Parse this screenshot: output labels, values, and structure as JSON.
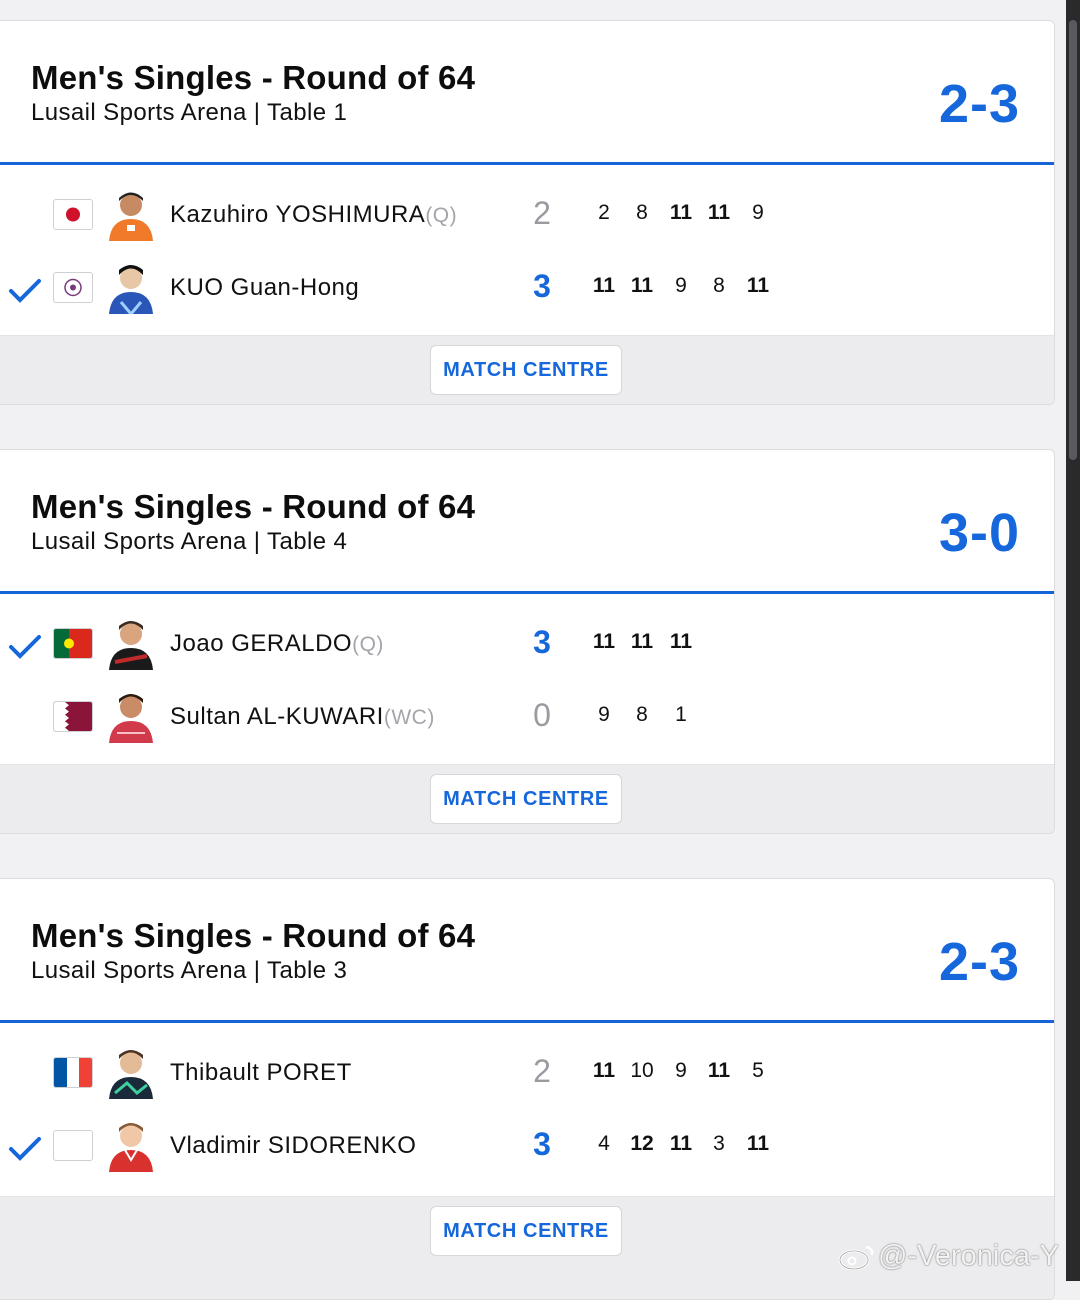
{
  "matches": [
    {
      "title": "Men's Singles - Round of 64",
      "venue": "Lusail Sports Arena | Table 1",
      "total": "2-3",
      "players": [
        {
          "name": "Kazuhiro YOSHIMURA",
          "tag": "(Q)",
          "flag": "japan-flag",
          "winner": false,
          "games": "2",
          "sets": [
            "2",
            "8",
            "11",
            "11",
            "9"
          ],
          "bold": [
            false,
            false,
            true,
            true,
            false
          ]
        },
        {
          "name": "KUO Guan-Hong",
          "tag": "",
          "flag": "chinese-taipei-flag",
          "winner": true,
          "games": "3",
          "sets": [
            "11",
            "11",
            "9",
            "8",
            "11"
          ],
          "bold": [
            true,
            true,
            false,
            false,
            true
          ]
        }
      ],
      "button": "MATCH CENTRE"
    },
    {
      "title": "Men's Singles - Round of 64",
      "venue": "Lusail Sports Arena | Table 4",
      "total": "3-0",
      "players": [
        {
          "name": "Joao GERALDO",
          "tag": "(Q)",
          "flag": "portugal-flag",
          "winner": true,
          "games": "3",
          "sets": [
            "11",
            "11",
            "11"
          ],
          "bold": [
            true,
            true,
            true
          ]
        },
        {
          "name": "Sultan AL-KUWARI",
          "tag": "(WC)",
          "flag": "qatar-flag",
          "winner": false,
          "games": "0",
          "sets": [
            "9",
            "8",
            "1"
          ],
          "bold": [
            false,
            false,
            false
          ]
        }
      ],
      "button": "MATCH CENTRE"
    },
    {
      "title": "Men's Singles - Round of 64",
      "venue": "Lusail Sports Arena | Table 3",
      "total": "2-3",
      "players": [
        {
          "name": "Thibault PORET",
          "tag": "",
          "flag": "france-flag",
          "winner": false,
          "games": "2",
          "sets": [
            "11",
            "10",
            "9",
            "11",
            "5"
          ],
          "bold": [
            true,
            false,
            false,
            true,
            false
          ]
        },
        {
          "name": "Vladimir SIDORENKO",
          "tag": "",
          "flag": "neutral-flag",
          "winner": true,
          "games": "3",
          "sets": [
            "4",
            "12",
            "11",
            "3",
            "11"
          ],
          "bold": [
            false,
            true,
            true,
            false,
            true
          ]
        }
      ],
      "button": "MATCH CENTRE"
    }
  ],
  "watermark": "@-Veronica-Y",
  "colors": {
    "accent": "#1667db",
    "header_rule": "#1565d8",
    "footer_bg": "#ececee"
  }
}
